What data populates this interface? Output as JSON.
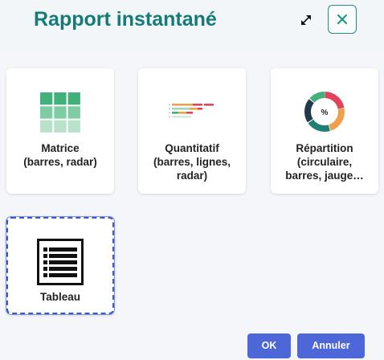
{
  "dialog": {
    "title": "Rapport instantané"
  },
  "options": [
    {
      "label": "Matrice\n(barres, radar)",
      "icon": "matrix-grid-icon"
    },
    {
      "label": "Quantitatif\n(barres, lignes,\nradar)",
      "icon": "stacked-bars-icon"
    },
    {
      "label": "Répartition\n(circulaire,\nbarres, jauge…",
      "icon": "donut-chart-icon",
      "center_text": "%"
    },
    {
      "label": "Tableau",
      "icon": "table-list-icon",
      "selected": true
    }
  ],
  "footer": {
    "ok_label": "OK",
    "cancel_label": "Annuler"
  },
  "colors": {
    "title": "#167a76",
    "primary_button": "#4e67d8",
    "selected_border": "#3a56c7"
  }
}
